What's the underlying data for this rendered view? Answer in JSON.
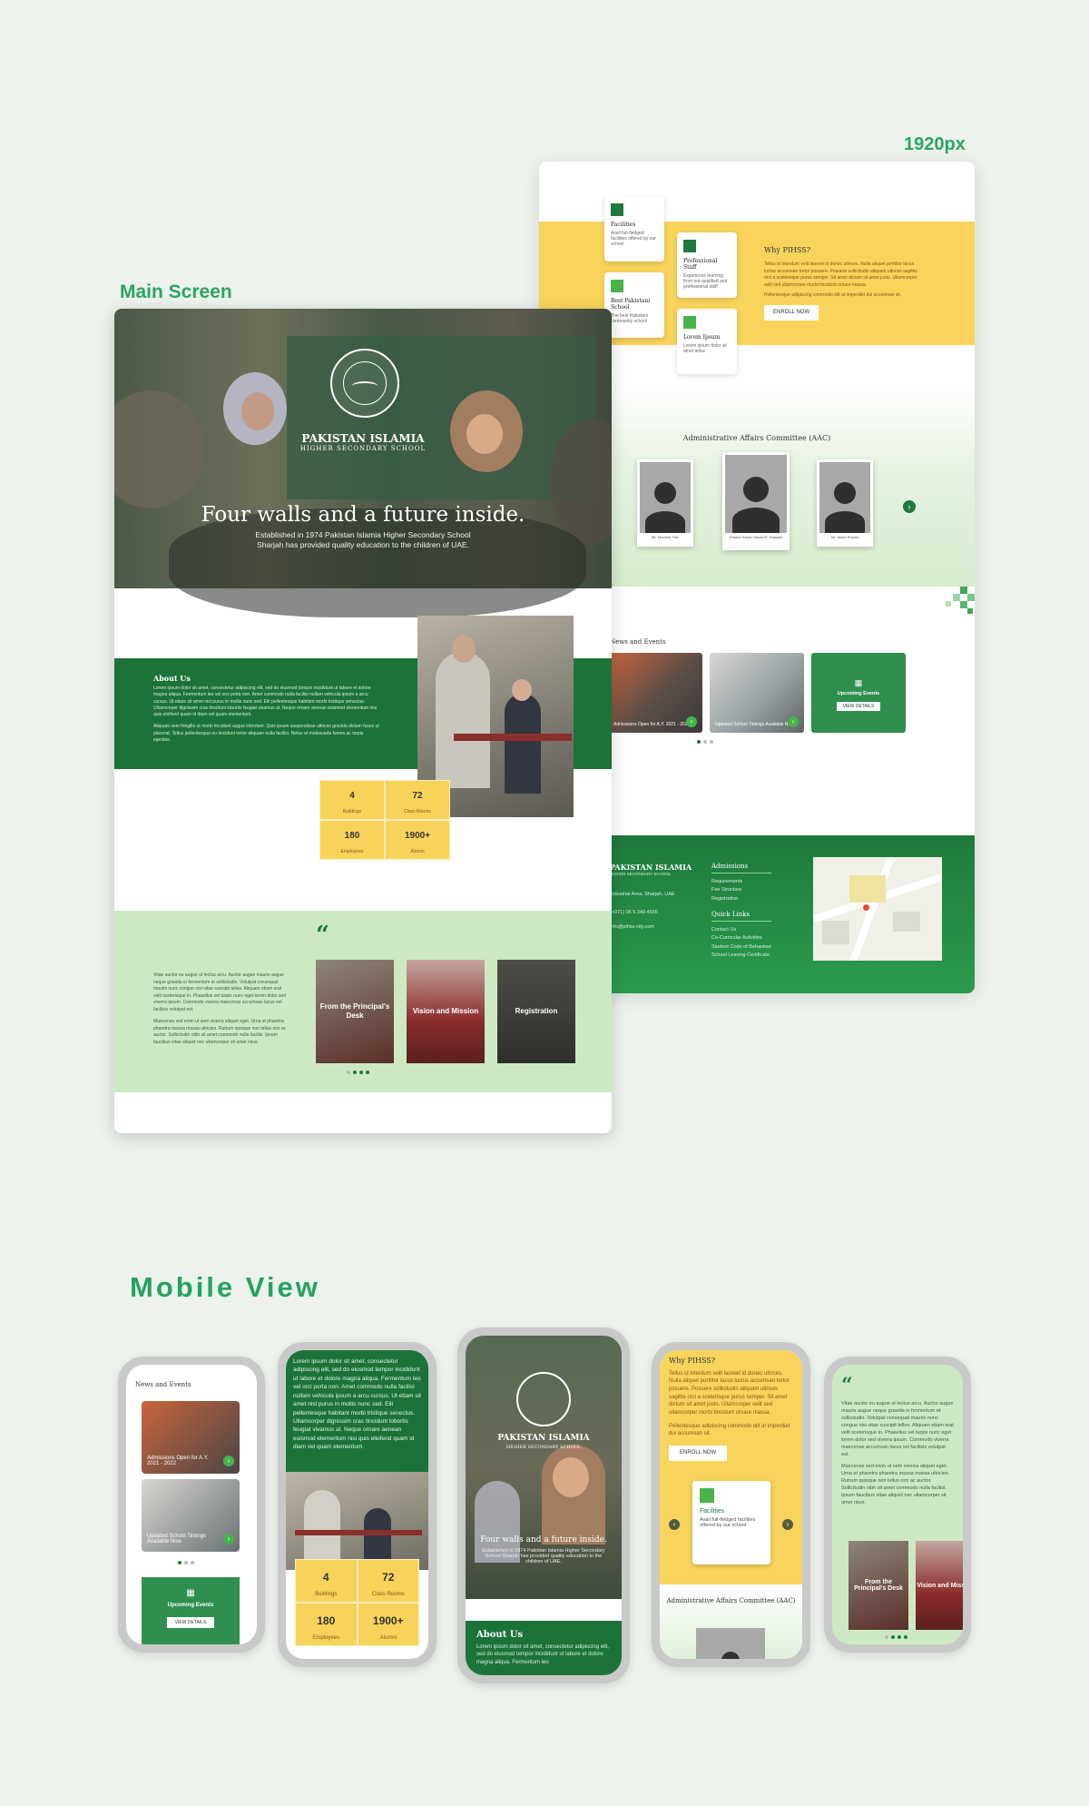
{
  "labels": {
    "main_screen": "Main Screen",
    "size": "1920px",
    "mobile_view": "Mobile View"
  },
  "desktop2": {
    "cards": [
      {
        "title": "Facilities",
        "text": "Avail full-fledged facilities offered by our school"
      },
      {
        "title": "Best Pakistani School",
        "text": "The best Pakistani community school"
      },
      {
        "title": "Professional Staff",
        "text": "Experience learning from our qualified and professional staff"
      },
      {
        "title": "Lorem Ipsum",
        "text": "Lorem ipsum dolor sit amet tellus"
      }
    ],
    "why_title": "Why PIHSS?",
    "why_text": "Tellus id interdum velit laoreet id donec ultrices. Nulla aliquet porttitor lacus luctus accumsan tortor posuere. Posuere sollicitudin aliquam ultrices sagittis orci a scelerisque purus semper. Sit amet dictum sit amet justo. Ullamcorper velit sed ullamcorper morbi tincidunt ornare massa.",
    "why_text2": "Pellentesque adipiscing commodo elit at imperdiet dui accumsan sit.",
    "enroll": "ENROLL NOW",
    "aac_title": "Administrative Affairs Committee (AAC)",
    "members": [
      "Mr. Member Title",
      "Rashid Sultan Hamid R. Hawash",
      "Mr. Abdul Rashid"
    ],
    "news_title": "News and Events",
    "news": [
      {
        "caption": "Admissions Open for A.Y. 2021 - 2022"
      },
      {
        "caption": "Updated School Timings Available Now"
      },
      {
        "caption": "Upcoming Events",
        "button": "VIEW DETAILS"
      }
    ],
    "footer": {
      "school": "PAKISTAN ISLAMIA",
      "school_sub": "HIGHER SECONDARY SCHOOL",
      "address": "Industrial Area, Sharjah, UAE",
      "phone": "(+971) 06 5 349 4556",
      "email": "info@pihss-city.com",
      "admissions_title": "Admissions",
      "admissions": [
        "Requirements",
        "Fee Structure",
        "Registration"
      ],
      "quick_title": "Quick Links",
      "quick": [
        "Contact Us",
        "Co-Curricular Activities",
        "Student Code of Behaviour",
        "School Leaving Certificate"
      ]
    }
  },
  "desktop1": {
    "school": "PAKISTAN ISLAMIA",
    "school_sub": "HIGHER SECONDARY SCHOOL",
    "hero_title": "Four walls and a future inside.",
    "hero_sub": "Established in 1974 Pakistan Islamia Higher Secondary School Sharjah has provided quality education to the children of UAE.",
    "about_title": "About Us",
    "about_text": "Lorem ipsum dolor sit amet, consectetur adipiscing elit, sed do eiusmod tempor incididunt ut labore et dolore magna aliqua. Fermentum leo vel orci porta non. Amet commodo nulla facilisi nullam vehicula ipsum a arcu cursus. Ut etiam sit amet nisl purus in mollis nunc sed. Elit pellentesque habitant morbi tristique senectus. Ullamcorper dignissim cras tincidunt lobortis feugiat vivamus at. Neque ornare aenean euismod elementum nisi quis eleifend quam id diam vel quam elementum.",
    "about_text2": "Aliquam sem fringilla ut morbi tincidunt augue interdum. Quis ipsum suspendisse ultrices gravida dictum fusce ut placerat. Tellus pellentesque eu tincidunt tortor aliquam nulla facilisi. Netus et malesuada fames ac turpis egestas.",
    "stats": [
      {
        "n": "4",
        "l": "Buildings"
      },
      {
        "n": "72",
        "l": "Class Rooms"
      },
      {
        "n": "180",
        "l": "Employees"
      },
      {
        "n": "1900+",
        "l": "Alumni"
      }
    ],
    "quote_text": "Vitae auctor eu augue ut lectus arcu. Auctor augue mauris augue neque gravida in fermentum et sollicitudin. Volutpat consequat mauris nunc congue nisi vitae suscipit tellus. Aliquam etiam erat velit scelerisque in. Phasellus vel turpis nunc eget lorem dolor sed viverra ipsum. Commodo viverra maecenas accumsan lacus vel facilisis volutpat est.",
    "quote_text2": "Maecenas sed enim ut sem viverra aliquet eget. Urna et pharetra pharetra massa massa ultricies. Rutrum quisque non tellus orci ac auctor. Sollicitudin nibh sit amet commodo nulla facilisi. Ipsum faucibus vitae aliquet nec ullamcorper sit amet risus.",
    "tiles": [
      "From the Principal's Desk",
      "Vision and Mission",
      "Registration"
    ]
  },
  "mobile": {
    "p1": {
      "title": "News and Events",
      "n1": "Admissions Open for A.Y. 2021 - 2022",
      "n2": "Updated School Timings Available Now",
      "events": "Upcoming Events",
      "btn": "VIEW DETAILS"
    },
    "p2": {
      "text": "Lorem ipsum dolor sit amet, consectetur adipiscing elit, sed do eiusmod tempor incididunt ut labore et dolore magna aliqua. Fermentum leo vel orci porta non. Amet commodo nulla facilisi nullam vehicula ipsum a arcu cursus. Ut etiam sit amet nisl purus in mollis nunc sed. Elit pellentesque habitant morbi tristique senectus. Ullamcorper dignissim cras tincidunt lobortis feugiat vivamus at. Neque ornare aenean euismod elementum nisi quis eleifend quam id diam vel quam elementum.",
      "stats": [
        {
          "n": "4",
          "l": "Buildings"
        },
        {
          "n": "72",
          "l": "Class Rooms"
        },
        {
          "n": "180",
          "l": "Employees"
        },
        {
          "n": "1900+",
          "l": "Alumni"
        }
      ]
    },
    "p3": {
      "school": "PAKISTAN ISLAMIA",
      "school_sub": "HIGHER SECONDARY SCHOOL",
      "title": "Four walls and a future inside.",
      "sub": "Established in 1974 Pakistan Islamia Higher Secondary School Sharjah has provided quality education to the children of UAE.",
      "about": "About Us",
      "about_text": "Lorem ipsum dolor sit amet, consectetur adipiscing elit, sed do eiusmod tempor incididunt ut labore et dolore magna aliqua. Fermentum leo"
    },
    "p4": {
      "title": "Why PIHSS?",
      "text": "Tellus id interdum velit laoreet id donec ultrices. Nulla aliquet porttitor lacus luctus accumsan tortor posuere. Posuere sollicitudin aliquam ultrices sagittis orci a scelerisque purus semper. Sit amet dictum sit amet justo. Ullamcorper velit sed ullamcorper morbi tincidunt ornare massa.",
      "text2": "Pellentesque adipiscing commodo elit at imperdiet dui accumsan sit.",
      "btn": "ENROLL NOW",
      "card_title": "Facilities",
      "card_text": "Avail full-fledged facilities offered by our school",
      "aac": "Administrative Affairs Committee (AAC)"
    },
    "p5": {
      "text": "Vitae auctor eu augue ut lectus arcu. Auctor augue mauris augue neque gravida in fermentum et sollicitudin. Volutpat consequat mauris nunc congue nisi vitae suscipit tellus. Aliquam etiam erat velit scelerisque in. Phasellus vel turpis nunc eget lorem dolor sed viverra ipsum. Commodo viverra maecenas accumsan lacus vel facilisis volutpat est.",
      "text2": "Maecenas sed enim ut sem viverra aliquet eget. Urna et pharetra pharetra massa massa ultricies. Rutrum quisque non tellus orci ac auctor. Sollicitudin nibh sit amet commodo nulla facilisi. Ipsum faucibus vitae aliquet nec ullamcorper sit amet risus.",
      "tile1": "From the Principal's Desk",
      "tile2": "Vision and Mission"
    }
  }
}
